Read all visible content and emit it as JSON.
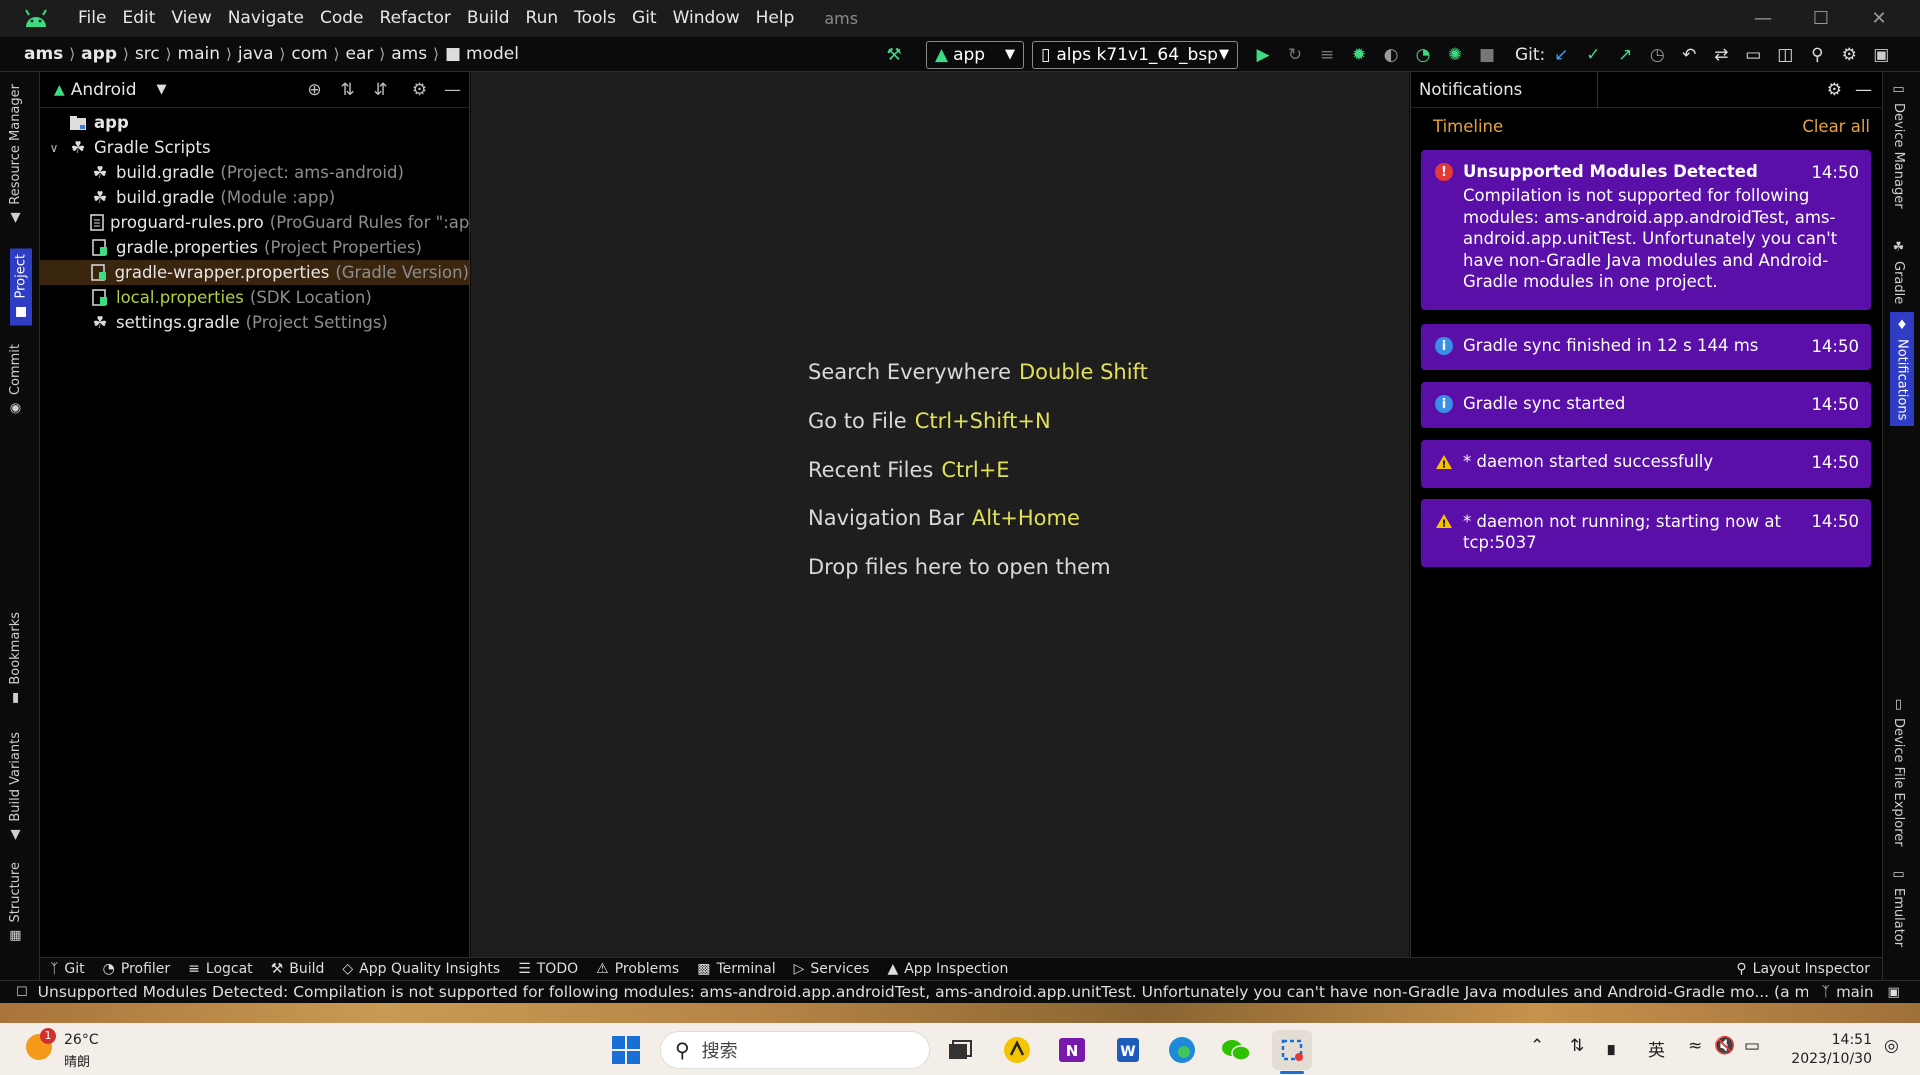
{
  "menubar": {
    "items": [
      {
        "label": "File",
        "mn": "F"
      },
      {
        "label": "Edit",
        "mn": "E"
      },
      {
        "label": "View",
        "mn": "V"
      },
      {
        "label": "Navigate",
        "mn": "N"
      },
      {
        "label": "Code",
        "mn": "C"
      },
      {
        "label": "Refactor",
        "mn": "R"
      },
      {
        "label": "Build",
        "mn": "B"
      },
      {
        "label": "Run",
        "mn": "u"
      },
      {
        "label": "Tools",
        "mn": "T"
      },
      {
        "label": "Git",
        "mn": "G"
      },
      {
        "label": "Window",
        "mn": "W"
      },
      {
        "label": "Help",
        "mn": "H"
      }
    ],
    "project_title": "ams"
  },
  "breadcrumb": [
    "ams",
    "app",
    "src",
    "main",
    "java",
    "com",
    "ear",
    "ams",
    "model"
  ],
  "toolbar": {
    "run_config": "app",
    "device": "alps k71v1_64_bsp",
    "git_label": "Git:"
  },
  "left_strip": {
    "resource_manager": "Resource Manager",
    "project": "Project",
    "commit": "Commit",
    "bookmarks": "Bookmarks",
    "build_variants": "Build Variants",
    "structure": "Structure"
  },
  "right_strip": {
    "device_manager": "Device Manager",
    "gradle": "Gradle",
    "notifications": "Notifications",
    "device_file_explorer": "Device File Explorer",
    "emulator": "Emulator"
  },
  "project_panel": {
    "view_mode": "Android",
    "tree": [
      {
        "name": "app",
        "hint": ""
      },
      {
        "name": "Gradle Scripts",
        "hint": ""
      },
      {
        "name": "build.gradle",
        "hint": "(Project: ams-android)"
      },
      {
        "name": "build.gradle",
        "hint": "(Module :app)"
      },
      {
        "name": "proguard-rules.pro",
        "hint": "(ProGuard Rules for \":app\")"
      },
      {
        "name": "gradle.properties",
        "hint": "(Project Properties)"
      },
      {
        "name": "gradle-wrapper.properties",
        "hint": "(Gradle Version)"
      },
      {
        "name": "local.properties",
        "hint": "(SDK Location)"
      },
      {
        "name": "settings.gradle",
        "hint": "(Project Settings)"
      }
    ]
  },
  "editor": {
    "hints": [
      {
        "label": "Search Everywhere",
        "key": "Double Shift"
      },
      {
        "label": "Go to File",
        "key": "Ctrl+Shift+N"
      },
      {
        "label": "Recent Files",
        "key": "Ctrl+E"
      },
      {
        "label": "Navigation Bar",
        "key": "Alt+Home"
      },
      {
        "label": "Drop files here to open them",
        "key": ""
      }
    ]
  },
  "notifications": {
    "title": "Notifications",
    "timeline": "Timeline",
    "clear_all": "Clear all",
    "cards": [
      {
        "title": "Unsupported Modules Detected",
        "time": "14:50",
        "level": "error",
        "body": "Compilation is not supported for following modules: ams-android.app.androidTest, ams-android.app.unitTest. Unfortunately you can't have non-Gradle Java modules and Android-Gradle modules in one project."
      },
      {
        "title": "Gradle sync finished in 12 s 144 ms",
        "time": "14:50",
        "level": "info",
        "body": ""
      },
      {
        "title": "Gradle sync started",
        "time": "14:50",
        "level": "info",
        "body": ""
      },
      {
        "title": "* daemon started successfully",
        "time": "14:50",
        "level": "warning",
        "body": ""
      },
      {
        "title": "* daemon not running; starting now at tcp:5037",
        "time": "14:50",
        "level": "warning",
        "body": ""
      }
    ]
  },
  "tool_windows": {
    "left": [
      "Git",
      "Profiler",
      "Logcat",
      "Build",
      "App Quality Insights",
      "TODO",
      "Problems",
      "Terminal",
      "Services",
      "App Inspection"
    ],
    "right": "Layout Inspector"
  },
  "status_bar": {
    "message": "Unsupported Modules Detected: Compilation is not supported for following modules: ams-android.app.androidTest, ams-android.app.unitTest. Unfortunately you can't have non-Gradle Java modules and Android-Gradle mo... (a minute ag",
    "branch": "main"
  },
  "taskbar": {
    "weather_temp": "26°C",
    "weather_desc": "晴朗",
    "weather_badge": "1",
    "search_placeholder": "搜索",
    "ime": "英",
    "time": "14:51",
    "date": "2023/10/30"
  },
  "colors": {
    "accent": "#2f3cc4",
    "notification_card": "#5a0fa8",
    "shortcut_key": "#e0e05a",
    "selected_row": "#3a250f",
    "timeline": "#e6a33a"
  }
}
